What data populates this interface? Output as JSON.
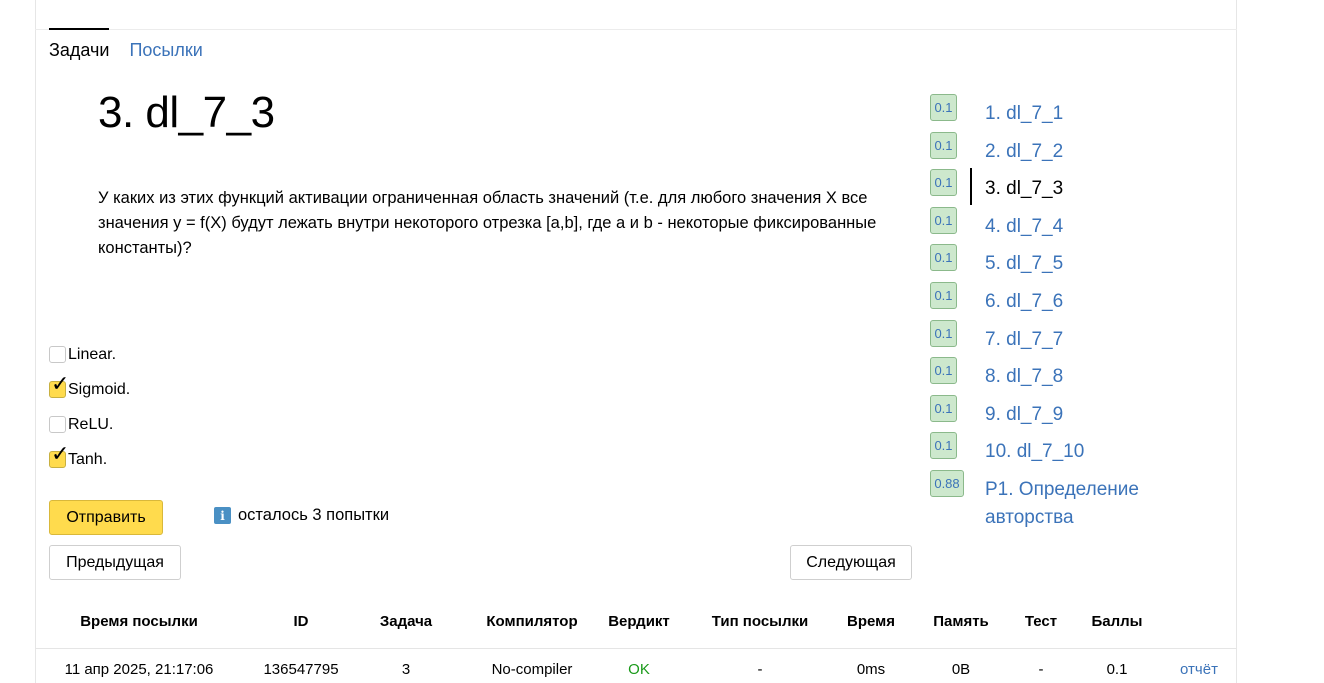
{
  "tabs": {
    "problems": "Задачи",
    "submissions": "Посылки"
  },
  "problem": {
    "title": "3. dl_7_3",
    "statement": "У каких из этих функций активации ограниченная область значений (т.е. для любого значения X все значения y = f(X) будут лежать внутри некоторого отрезка [a,b], где a и b - некоторые фиксированные константы)?"
  },
  "options": [
    {
      "label": "Linear.",
      "checked": false
    },
    {
      "label": "Sigmoid.",
      "checked": true
    },
    {
      "label": "ReLU.",
      "checked": false
    },
    {
      "label": "Tanh.",
      "checked": true
    }
  ],
  "buttons": {
    "submit": "Отправить",
    "prev": "Предыдущая",
    "next": "Следующая"
  },
  "attempts_text": "осталось 3 попытки",
  "info_icon": "i",
  "checkmark": "✓",
  "problem_list": [
    {
      "score": "0.1",
      "name": "1. dl_7_1"
    },
    {
      "score": "0.1",
      "name": "2. dl_7_2"
    },
    {
      "score": "0.1",
      "name": "3. dl_7_3"
    },
    {
      "score": "0.1",
      "name": "4. dl_7_4"
    },
    {
      "score": "0.1",
      "name": "5. dl_7_5"
    },
    {
      "score": "0.1",
      "name": "6. dl_7_6"
    },
    {
      "score": "0.1",
      "name": "7. dl_7_7"
    },
    {
      "score": "0.1",
      "name": "8. dl_7_8"
    },
    {
      "score": "0.1",
      "name": "9. dl_7_9"
    },
    {
      "score": "0.1",
      "name": "10. dl_7_10"
    },
    {
      "score": "0.88",
      "name": "P1. Определение авторства"
    }
  ],
  "submissions_table": {
    "headers": [
      "Время посылки",
      "ID",
      "Задача",
      "Компилятор",
      "Вердикт",
      "Тип посылки",
      "Время",
      "Память",
      "Тест",
      "Баллы"
    ],
    "rows": [
      [
        "11 апр 2025, 21:17:06",
        "136547795",
        "3",
        "No-compiler",
        "OK",
        "-",
        "0ms",
        "0B",
        "-",
        "0.1",
        "отчёт"
      ]
    ]
  },
  "colors": {
    "link": "#3b73b9",
    "accent": "#ffdb4d",
    "score_bg": "#cde8cd",
    "ok": "#1a9a1a"
  }
}
